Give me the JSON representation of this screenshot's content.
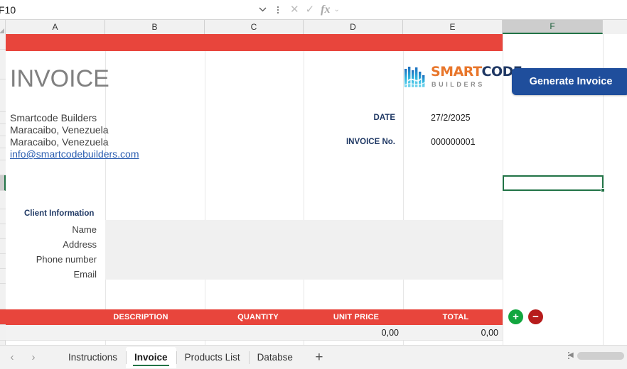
{
  "formula_bar": {
    "name_box_value": "F10",
    "name_box_chevron": "chevron-down-icon",
    "kebab": "more-options-icon",
    "cancel_icon": "✕",
    "confirm_icon": "✓",
    "fx_label": "fx",
    "fx_chevron": "⌄",
    "formula_value": ""
  },
  "grid": {
    "columns": [
      "A",
      "B",
      "C",
      "D",
      "E",
      "F"
    ],
    "selected_column": "F",
    "selected_cell": "F10"
  },
  "invoice": {
    "title": "INVOICE",
    "company_lines": [
      "Smartcode Builders",
      "Maracaibo, Venezuela",
      "Maracaibo, Venezuela"
    ],
    "email": "info@smartcodebuilders.com",
    "logo": {
      "mark": "circuit-logo-icon",
      "text_part1": "SMART",
      "text_part2": "CODE",
      "subtitle": "BUILDERS",
      "color_part1": "#e8762b",
      "color_part2": "#1f3864",
      "color_subtitle": "#8a8a8a"
    },
    "meta": [
      {
        "label": "DATE",
        "value": "27/2/2025"
      },
      {
        "label": "INVOICE No.",
        "value": "000000001"
      }
    ],
    "client_section_title": "Client Information",
    "client_fields": [
      "Name",
      "Address",
      "Phone number",
      "Email"
    ],
    "items_header": [
      "DESCRIPTION",
      "QUANTITY",
      "UNIT PRICE",
      "TOTAL"
    ],
    "items_rows": [
      {
        "description": "",
        "quantity": "",
        "unit_price": "0,00",
        "total": "0,00"
      }
    ],
    "add_row_label": "+",
    "remove_row_label": "−",
    "generate_button": "Generate Invoice",
    "accent_red": "#e8453c",
    "accent_blue": "#1f4e9c",
    "accent_green": "#12a63f",
    "accent_dark_red": "#b71c1c"
  },
  "tabbar": {
    "prev_icon": "‹",
    "next_icon": "›",
    "tabs": [
      {
        "label": "Instructions",
        "active": false
      },
      {
        "label": "Invoice",
        "active": true
      },
      {
        "label": "Products List",
        "active": false
      },
      {
        "label": "Databse",
        "active": false
      }
    ],
    "add_sheet_label": "+",
    "options_icon": "more-options-icon",
    "scroll_left_icon": "◀"
  }
}
